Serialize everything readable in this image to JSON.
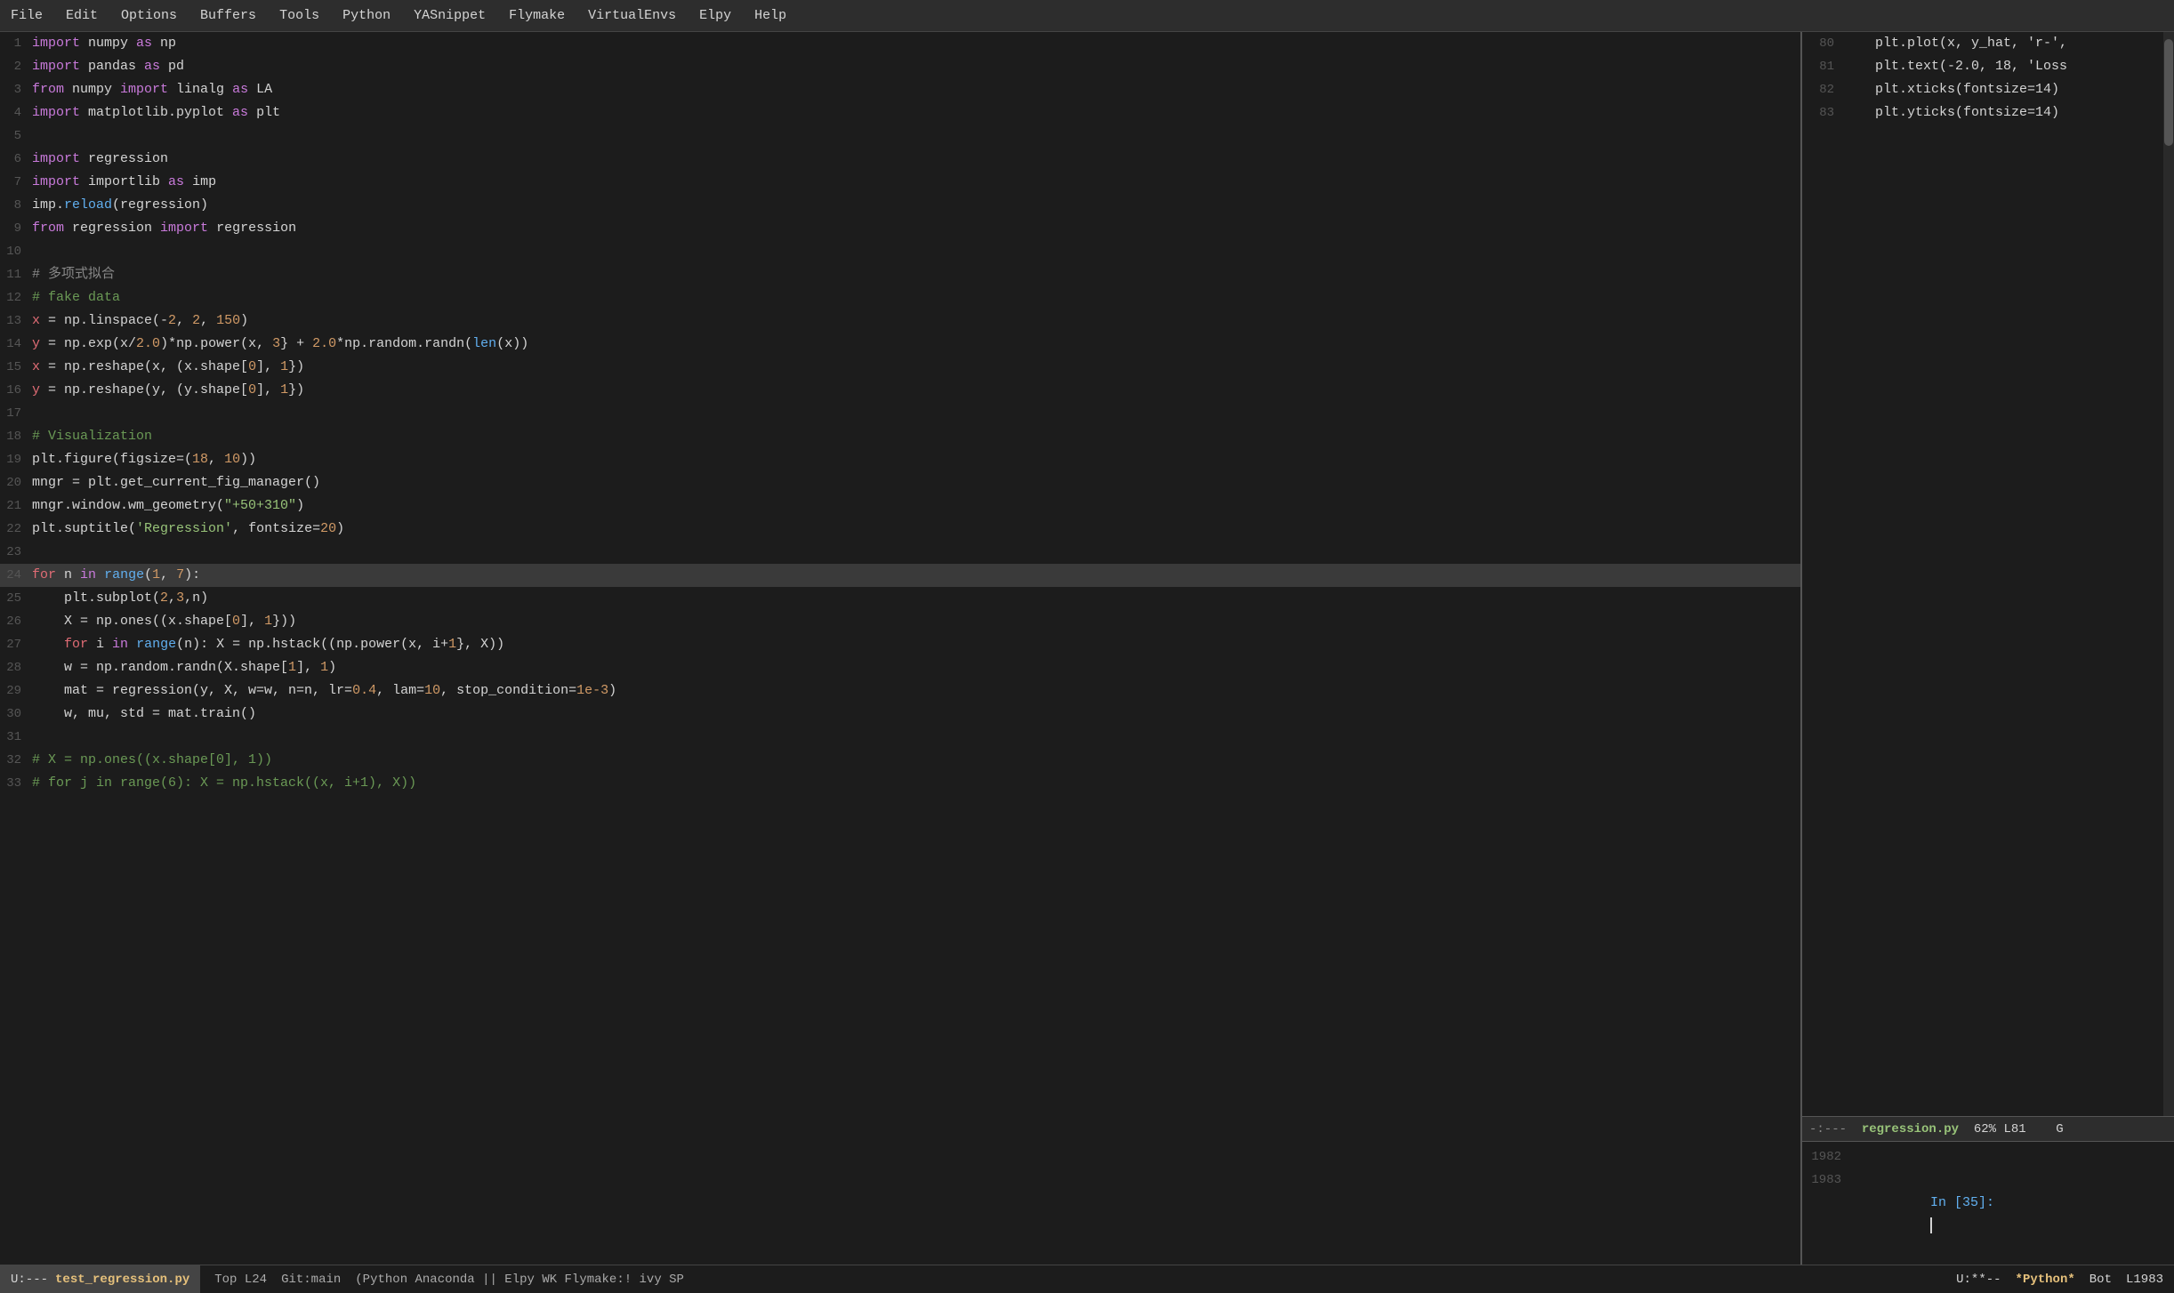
{
  "menubar": {
    "items": [
      "File",
      "Edit",
      "Options",
      "Buffers",
      "Tools",
      "Python",
      "YASnippet",
      "Flymake",
      "VirtualEnvs",
      "Elpy",
      "Help"
    ]
  },
  "editor": {
    "lines": [
      {
        "num": "1",
        "tokens": [
          {
            "t": "import",
            "c": "kw"
          },
          {
            "t": " numpy ",
            "c": "id"
          },
          {
            "t": "as",
            "c": "kwas"
          },
          {
            "t": " np",
            "c": "id"
          }
        ]
      },
      {
        "num": "2",
        "tokens": [
          {
            "t": "import",
            "c": "kw"
          },
          {
            "t": " pandas ",
            "c": "id"
          },
          {
            "t": "as",
            "c": "kwas"
          },
          {
            "t": " pd",
            "c": "id"
          }
        ]
      },
      {
        "num": "3",
        "tokens": [
          {
            "t": "from",
            "c": "kw"
          },
          {
            "t": " numpy ",
            "c": "id"
          },
          {
            "t": "import",
            "c": "kw"
          },
          {
            "t": " linalg ",
            "c": "id"
          },
          {
            "t": "as",
            "c": "kwas"
          },
          {
            "t": " LA",
            "c": "id"
          }
        ]
      },
      {
        "num": "4",
        "tokens": [
          {
            "t": "import",
            "c": "kw"
          },
          {
            "t": " matplotlib.pyplot ",
            "c": "id"
          },
          {
            "t": "as",
            "c": "kwas"
          },
          {
            "t": " plt",
            "c": "id"
          }
        ]
      },
      {
        "num": "5",
        "tokens": []
      },
      {
        "num": "6",
        "tokens": [
          {
            "t": "import",
            "c": "kw"
          },
          {
            "t": " regression",
            "c": "id"
          }
        ]
      },
      {
        "num": "7",
        "tokens": [
          {
            "t": "import",
            "c": "kw"
          },
          {
            "t": " importlib ",
            "c": "id"
          },
          {
            "t": "as",
            "c": "kwas"
          },
          {
            "t": " imp",
            "c": "id"
          }
        ]
      },
      {
        "num": "8",
        "tokens": [
          {
            "t": "imp.",
            "c": "id"
          },
          {
            "t": "reload",
            "c": "blue"
          },
          {
            "t": "(regression)",
            "c": "id"
          }
        ]
      },
      {
        "num": "9",
        "tokens": [
          {
            "t": "from",
            "c": "kw"
          },
          {
            "t": " regression ",
            "c": "id"
          },
          {
            "t": "import",
            "c": "kw"
          },
          {
            "t": " regression",
            "c": "id"
          }
        ]
      },
      {
        "num": "10",
        "tokens": []
      },
      {
        "num": "11",
        "tokens": [
          {
            "t": "# 多项式拟合",
            "c": "cm-cn"
          }
        ]
      },
      {
        "num": "12",
        "tokens": [
          {
            "t": "# fake data",
            "c": "cm"
          }
        ]
      },
      {
        "num": "13",
        "tokens": [
          {
            "t": "x",
            "c": "red"
          },
          {
            "t": " = np.linspace(-",
            "c": "id"
          },
          {
            "t": "2",
            "c": "num"
          },
          {
            "t": ", ",
            "c": "id"
          },
          {
            "t": "2",
            "c": "num"
          },
          {
            "t": ", ",
            "c": "id"
          },
          {
            "t": "150",
            "c": "num"
          },
          {
            "t": ")",
            "c": "id"
          }
        ]
      },
      {
        "num": "14",
        "tokens": [
          {
            "t": "y",
            "c": "red"
          },
          {
            "t": " = np.exp(x/",
            "c": "id"
          },
          {
            "t": "2.0",
            "c": "num"
          },
          {
            "t": ")*np.power(x, ",
            "c": "id"
          },
          {
            "t": "3",
            "c": "num"
          },
          {
            "t": "} + ",
            "c": "id"
          },
          {
            "t": "2.0",
            "c": "num"
          },
          {
            "t": "*np.random.randn(",
            "c": "id"
          },
          {
            "t": "len",
            "c": "blue"
          },
          {
            "t": "(x))",
            "c": "id"
          }
        ]
      },
      {
        "num": "15",
        "tokens": [
          {
            "t": "x",
            "c": "red"
          },
          {
            "t": " = np.reshape(x, (x.shape[",
            "c": "id"
          },
          {
            "t": "0",
            "c": "num"
          },
          {
            "t": "], ",
            "c": "id"
          },
          {
            "t": "1",
            "c": "num"
          },
          {
            "t": "})",
            "c": "id"
          }
        ]
      },
      {
        "num": "16",
        "tokens": [
          {
            "t": "y",
            "c": "red"
          },
          {
            "t": " = np.reshape(y, (y.shape[",
            "c": "id"
          },
          {
            "t": "0",
            "c": "num"
          },
          {
            "t": "], ",
            "c": "id"
          },
          {
            "t": "1",
            "c": "num"
          },
          {
            "t": "})",
            "c": "id"
          }
        ]
      },
      {
        "num": "17",
        "tokens": []
      },
      {
        "num": "18",
        "tokens": [
          {
            "t": "# Visualization",
            "c": "cm"
          }
        ]
      },
      {
        "num": "19",
        "tokens": [
          {
            "t": "plt.figure(figsize=(",
            "c": "id"
          },
          {
            "t": "18",
            "c": "num"
          },
          {
            "t": ", ",
            "c": "id"
          },
          {
            "t": "10",
            "c": "num"
          },
          {
            "t": "))",
            "c": "id"
          }
        ]
      },
      {
        "num": "20",
        "tokens": [
          {
            "t": "mngr",
            "c": "id"
          },
          {
            "t": " = plt.get_current_fig_manager()",
            "c": "id"
          }
        ]
      },
      {
        "num": "21",
        "tokens": [
          {
            "t": "mngr.window.wm_geometry(",
            "c": "id"
          },
          {
            "t": "\"+50+310\"",
            "c": "green"
          },
          {
            "t": ")",
            "c": "id"
          }
        ]
      },
      {
        "num": "22",
        "tokens": [
          {
            "t": "plt.suptitle(",
            "c": "id"
          },
          {
            "t": "'Regression'",
            "c": "green"
          },
          {
            "t": ", fontsize=",
            "c": "id"
          },
          {
            "t": "20",
            "c": "num"
          },
          {
            "t": ")",
            "c": "id"
          }
        ]
      },
      {
        "num": "23",
        "tokens": []
      },
      {
        "num": "24",
        "tokens": [
          {
            "t": "for",
            "c": "kw2"
          },
          {
            "t": " n ",
            "c": "id"
          },
          {
            "t": "in",
            "c": "kw"
          },
          {
            "t": " ",
            "c": "id"
          },
          {
            "t": "range",
            "c": "blue"
          },
          {
            "t": "(",
            "c": "id"
          },
          {
            "t": "1",
            "c": "num"
          },
          {
            "t": ", ",
            "c": "id"
          },
          {
            "t": "7",
            "c": "num"
          },
          {
            "t": "):",
            "c": "id"
          }
        ],
        "highlight": true
      },
      {
        "num": "25",
        "tokens": [
          {
            "t": "    plt.subplot(",
            "c": "id"
          },
          {
            "t": "2",
            "c": "num"
          },
          {
            "t": ",",
            "c": "id"
          },
          {
            "t": "3",
            "c": "num"
          },
          {
            "t": ",n)",
            "c": "id"
          }
        ]
      },
      {
        "num": "26",
        "tokens": [
          {
            "t": "    X",
            "c": "id"
          },
          {
            "t": " = np.ones((x.shape[",
            "c": "id"
          },
          {
            "t": "0",
            "c": "num"
          },
          {
            "t": "], ",
            "c": "id"
          },
          {
            "t": "1",
            "c": "num"
          },
          {
            "t": "})",
            "c": "id"
          },
          {
            "t": ")",
            "c": "id"
          }
        ]
      },
      {
        "num": "27",
        "tokens": [
          {
            "t": "    ",
            "c": "id"
          },
          {
            "t": "for",
            "c": "kw2"
          },
          {
            "t": " i ",
            "c": "id"
          },
          {
            "t": "in",
            "c": "kw"
          },
          {
            "t": " ",
            "c": "id"
          },
          {
            "t": "range",
            "c": "blue"
          },
          {
            "t": "(n): X = np.hstack((np.power(x, i+",
            "c": "id"
          },
          {
            "t": "1",
            "c": "num"
          },
          {
            "t": "}, X))",
            "c": "id"
          }
        ]
      },
      {
        "num": "28",
        "tokens": [
          {
            "t": "    w = np.random.randn(X.shape[",
            "c": "id"
          },
          {
            "t": "1",
            "c": "num"
          },
          {
            "t": "], ",
            "c": "id"
          },
          {
            "t": "1",
            "c": "num"
          },
          {
            "t": ")",
            "c": "id"
          }
        ]
      },
      {
        "num": "29",
        "tokens": [
          {
            "t": "    mat = regression(y, X, w=w, n=n, lr=",
            "c": "id"
          },
          {
            "t": "0.4",
            "c": "num"
          },
          {
            "t": ", lam=",
            "c": "id"
          },
          {
            "t": "10",
            "c": "num"
          },
          {
            "t": ", stop_condition=",
            "c": "id"
          },
          {
            "t": "1e-3",
            "c": "num"
          },
          {
            "t": ")",
            "c": "id"
          }
        ]
      },
      {
        "num": "30",
        "tokens": [
          {
            "t": "    w, mu, std = mat.train()",
            "c": "id"
          }
        ]
      },
      {
        "num": "31",
        "tokens": []
      },
      {
        "num": "32",
        "tokens": [
          {
            "t": "# X = np.ones((x.shape[0], 1))",
            "c": "cm"
          }
        ]
      },
      {
        "num": "33",
        "tokens": [
          {
            "t": "# for j in range(6): X = np.hstack((x, i+1), X))",
            "c": "cm"
          }
        ]
      }
    ]
  },
  "right_pane": {
    "lines": [
      {
        "num": "80",
        "tokens": [
          {
            "t": "    plt.plot(x, y_hat, 'r-',",
            "c": "id"
          }
        ]
      },
      {
        "num": "81",
        "tokens": [
          {
            "t": "    plt.text(-2.0, 18, 'Loss",
            "c": "id"
          }
        ]
      },
      {
        "num": "82",
        "tokens": [
          {
            "t": "    plt.xticks(fontsize=14)",
            "c": "id"
          }
        ]
      },
      {
        "num": "83",
        "tokens": [
          {
            "t": "    plt.yticks(fontsize=14)",
            "c": "id"
          }
        ]
      }
    ],
    "modeline": {
      "left": "-:---",
      "filename": "regression.py",
      "info": "  62% L81    G"
    },
    "ipython": {
      "line1982": "1982",
      "line1983": "1983",
      "prompt": "In [35]:"
    }
  },
  "statusbar": {
    "left_mode": "U:---",
    "filename": "test_regression.py",
    "position": "Top L24",
    "git": "Git:main",
    "python_info": "(Python Anaconda || Elpy WK Flymake:! ivy SP",
    "right_mode": "U:**--",
    "python_label": "*Python*",
    "bot": "Bot",
    "line_info": "L1983"
  }
}
